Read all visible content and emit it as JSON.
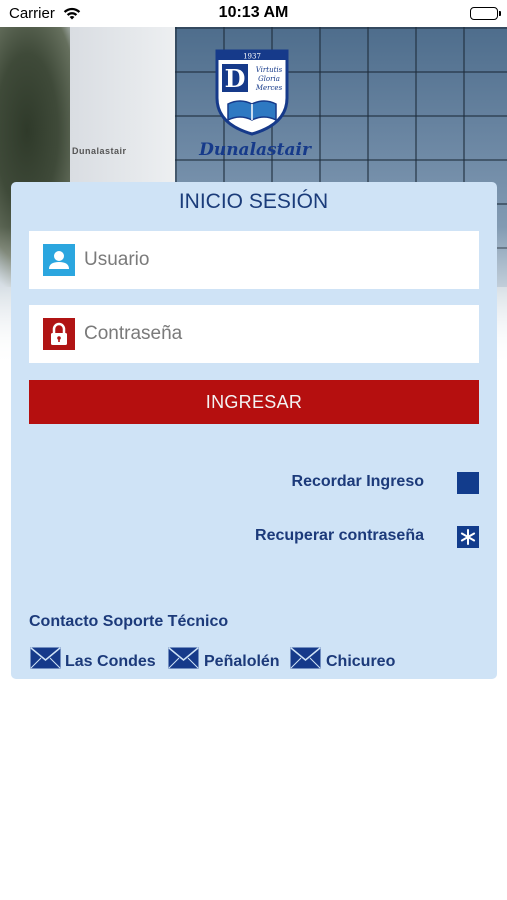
{
  "status_bar": {
    "carrier": "Carrier",
    "time": "10:13 AM",
    "icons": [
      "wifi-icon",
      "battery-icon"
    ]
  },
  "logo": {
    "year": "1937",
    "letter": "D",
    "motto_line1": "Virtutis",
    "motto_line2": "Gloria",
    "motto_line3": "Merces",
    "wordmark": "Dunalastair"
  },
  "background": {
    "building_sign": "Dunalastair"
  },
  "login": {
    "title": "INICIO SESIÓN",
    "username_placeholder": "Usuario",
    "username_value": "",
    "password_placeholder": "Contraseña",
    "password_value": "",
    "submit_label": "INGRESAR",
    "remember_label": "Recordar Ingreso",
    "remember_checked": false,
    "recover_label": "Recuperar contraseña"
  },
  "support": {
    "title": "Contacto Soporte Técnico",
    "contacts": [
      {
        "label": "Las Condes",
        "icon": "mail-icon"
      },
      {
        "label": "Peñalolén",
        "icon": "mail-icon"
      },
      {
        "label": "Chicureo",
        "icon": "mail-icon"
      }
    ]
  },
  "colors": {
    "card_background": "#cfe3f6",
    "primary_blue": "#1c3a7a",
    "submit_red": "#b50f0f",
    "user_icon_bg": "#2ba6df",
    "lock_icon_bg": "#b01414",
    "checkbox_blue": "#123c8c"
  }
}
